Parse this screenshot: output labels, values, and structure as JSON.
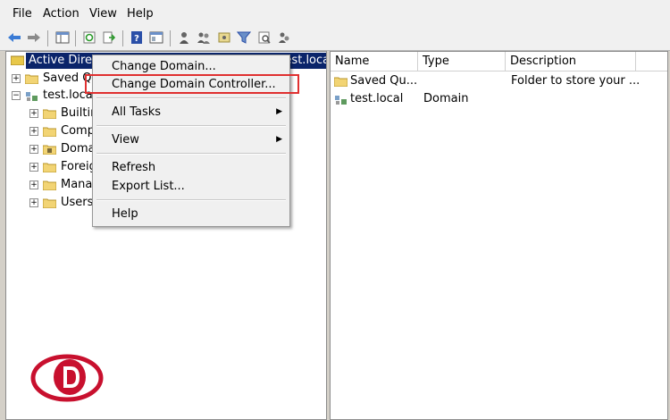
{
  "menubar": {
    "items": [
      "File",
      "Action",
      "View",
      "Help"
    ]
  },
  "toolbar": {
    "icons": [
      "back-arrow-icon",
      "forward-arrow-icon",
      "console-tree-icon",
      "refresh-icon",
      "export-list-icon",
      "help-icon",
      "properties-icon",
      "user-icon",
      "users-group-icon",
      "ou-icon",
      "filter-icon",
      "find-icon",
      "add-to-group-icon"
    ]
  },
  "tree": {
    "root_label": "Active Directory Users and Computers [DC.test.local]",
    "items": [
      {
        "label": "Saved Queries",
        "level": 1,
        "expander": "+"
      },
      {
        "label": "test.local",
        "level": 1,
        "expander": "−"
      },
      {
        "label": "Builtin",
        "level": 2,
        "expander": "+"
      },
      {
        "label": "Computers",
        "level": 2,
        "expander": "+"
      },
      {
        "label": "Domain Controllers",
        "level": 2,
        "expander": "+"
      },
      {
        "label": "ForeignSecurityPrincipals",
        "level": 2,
        "expander": "+"
      },
      {
        "label": "Managed Service Accounts",
        "level": 2,
        "expander": "+"
      },
      {
        "label": "Users",
        "level": 2,
        "expander": "+"
      }
    ]
  },
  "context_menu": {
    "items": [
      "Change Domain...",
      "Change Domain Controller...",
      "All Tasks",
      "View",
      "Refresh",
      "Export List...",
      "Help"
    ],
    "highlighted": "Change Domain Controller..."
  },
  "list": {
    "columns": [
      "Name",
      "Type",
      "Description"
    ],
    "rows": [
      {
        "name": "Saved Qu...",
        "type": "",
        "description": "Folder to store your ..."
      },
      {
        "name": "test.local",
        "type": "Domain",
        "description": ""
      }
    ]
  },
  "colors": {
    "selection": "#0a246a",
    "highlight_box": "#e03030",
    "logo": "#c8102e"
  }
}
